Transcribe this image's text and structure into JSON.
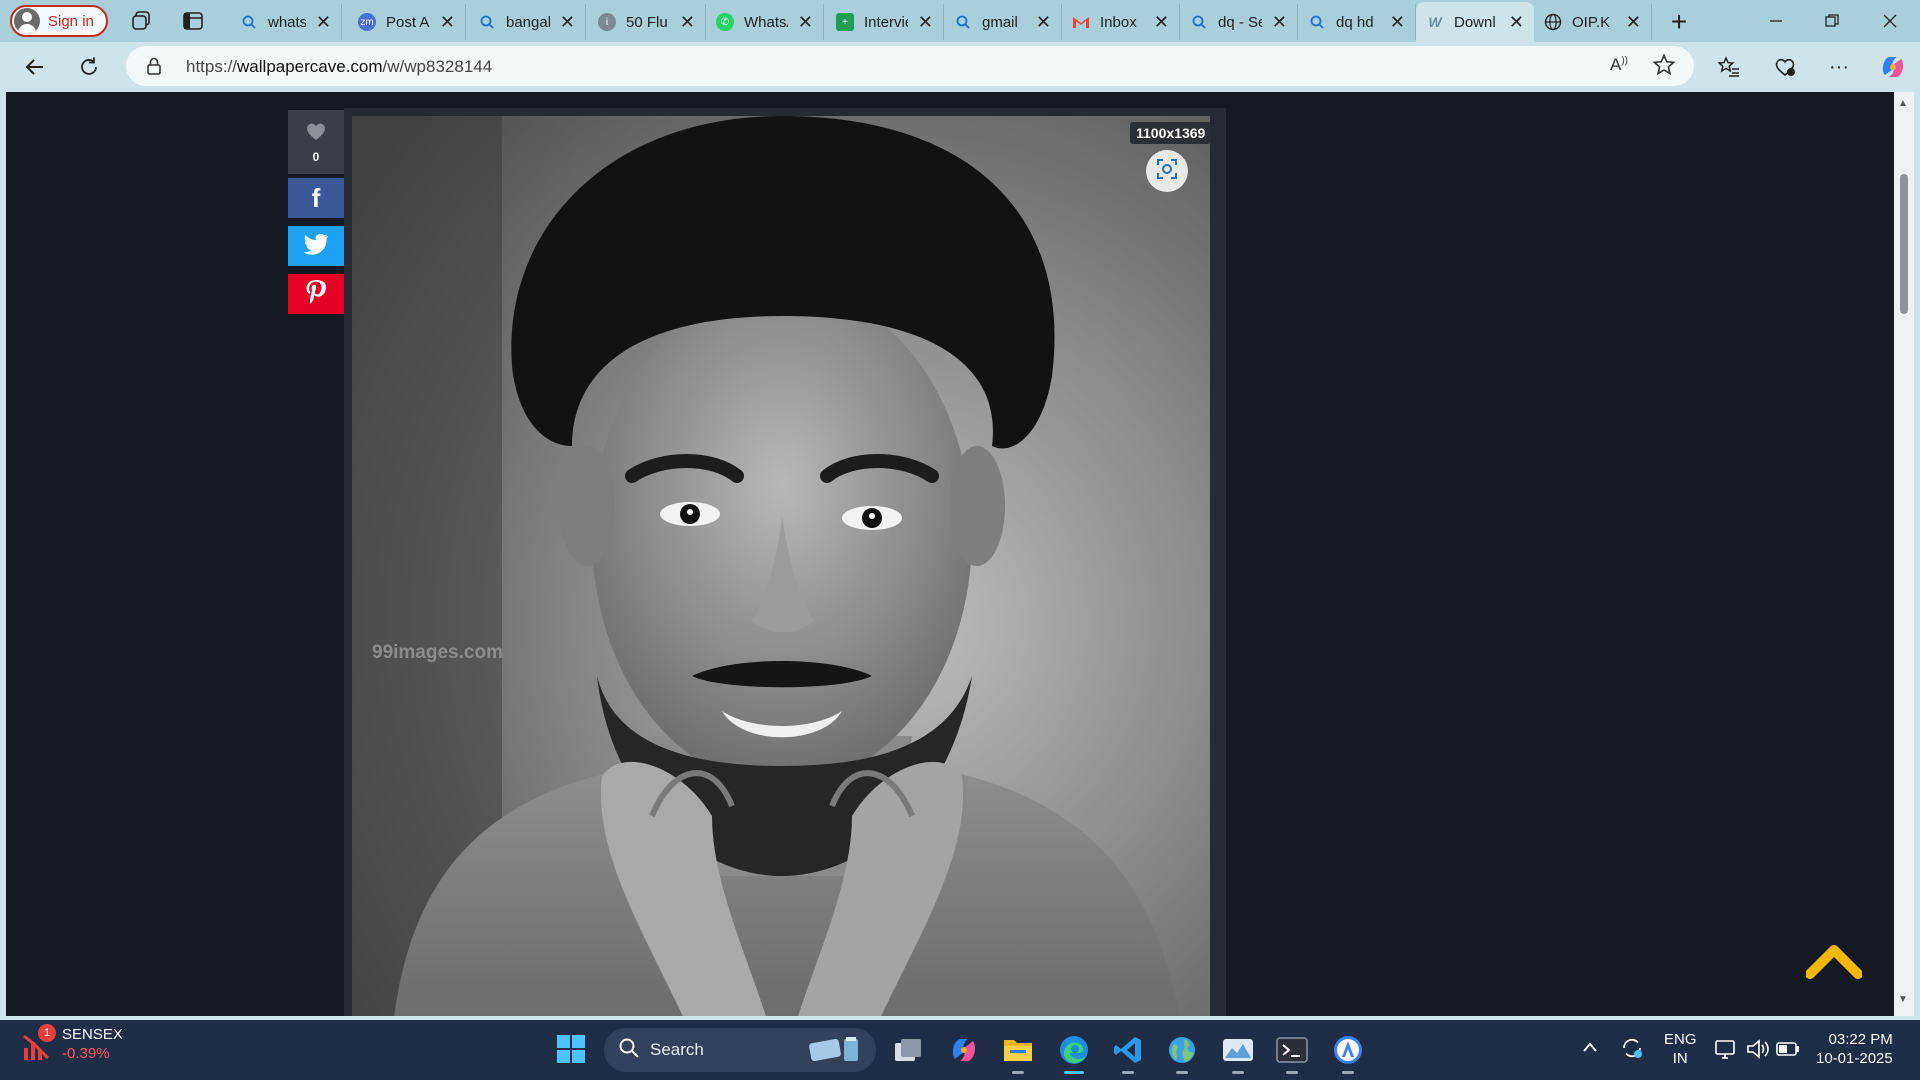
{
  "browser": {
    "signin_label": "Sign in",
    "tabs": [
      {
        "label": "whatsapp",
        "favicon": "search-icon"
      },
      {
        "label": "Post A",
        "favicon": "zm-icon"
      },
      {
        "label": "bangalore",
        "favicon": "search-icon"
      },
      {
        "label": "50 Flu",
        "favicon": "info-icon"
      },
      {
        "label": "WhatsApp",
        "favicon": "whatsapp-icon"
      },
      {
        "label": "Interview",
        "favicon": "sheet-icon"
      },
      {
        "label": "gmail",
        "favicon": "search-icon"
      },
      {
        "label": "Inbox",
        "favicon": "gmail-icon"
      },
      {
        "label": "dq - Sea",
        "favicon": "search-icon"
      },
      {
        "label": "dq hd",
        "favicon": "search-icon"
      },
      {
        "label": "Downl",
        "favicon": "wallpapercave-icon",
        "active": true
      },
      {
        "label": "OIP.K",
        "favicon": "globe-icon"
      }
    ],
    "close_glyph": "✕",
    "url_prefix": "https://",
    "url_host": "wallpapercave.com",
    "url_path": "/w/wp8328144"
  },
  "page": {
    "image_size": "1100x1369",
    "watermark": "99images.com",
    "like_count": "0",
    "share_buttons": [
      "facebook-icon",
      "twitter-icon",
      "pinterest-icon"
    ],
    "accent_colors": {
      "facebook": "#3b5998",
      "twitter": "#1da1f2",
      "pinterest": "#e60023",
      "scroll_top": "#f5b800"
    }
  },
  "taskbar": {
    "ticker_title": "SENSEX",
    "ticker_change": "-0.39%",
    "ticker_badge": "1",
    "search_placeholder": "Search",
    "lang_top": "ENG",
    "lang_bottom": "IN",
    "time": "03:22 PM",
    "date": "10-01-2025"
  }
}
